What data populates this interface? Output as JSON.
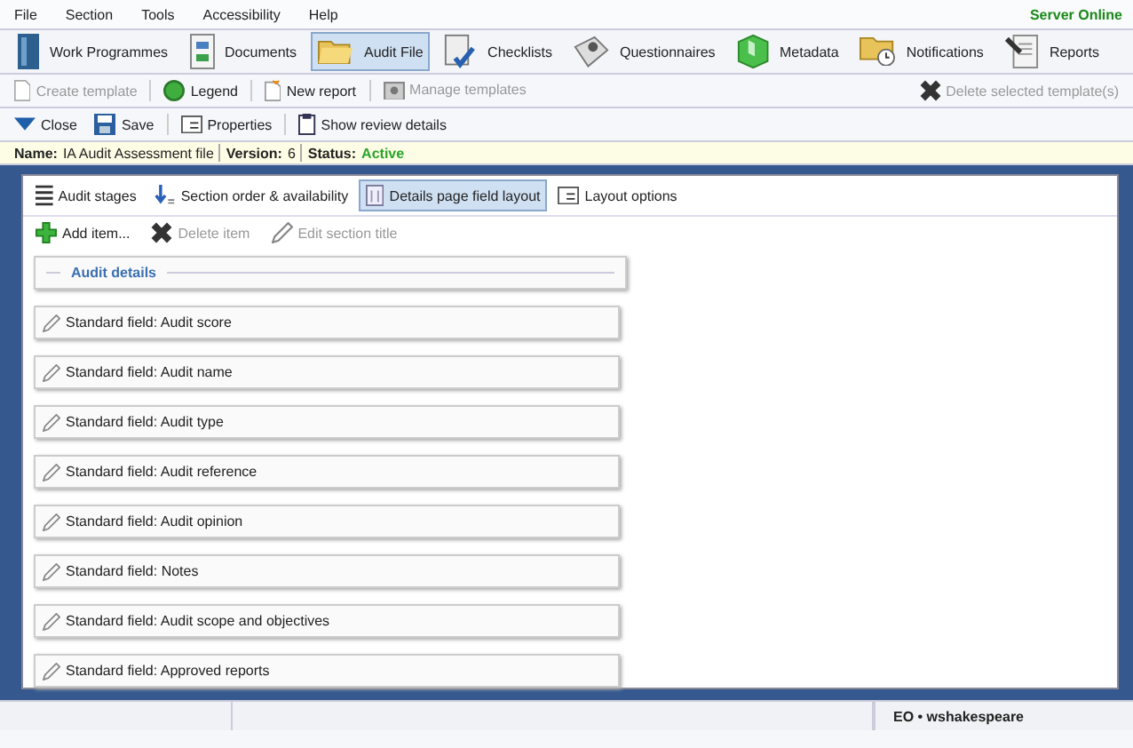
{
  "menu": [
    "File",
    "Section",
    "Tools",
    "Accessibility",
    "Help"
  ],
  "server_status": "Server Online",
  "modules": [
    {
      "label": "Work Programmes",
      "selected": false
    },
    {
      "label": "Documents",
      "selected": false
    },
    {
      "label": "Audit File",
      "selected": true
    },
    {
      "label": "Checklists",
      "selected": false
    },
    {
      "label": "Questionnaires",
      "selected": false
    },
    {
      "label": "Metadata",
      "selected": false
    },
    {
      "label": "Notifications",
      "selected": false
    },
    {
      "label": "Reports",
      "selected": false
    }
  ],
  "template_toolbar": {
    "left": [
      {
        "label": "Create template",
        "disabled": true
      },
      {
        "label": "Legend",
        "disabled": false
      },
      {
        "label": "New report",
        "disabled": false
      },
      {
        "label": "Manage templates",
        "disabled": true
      }
    ],
    "right": [
      {
        "label": "Delete selected template(s)",
        "disabled": true
      }
    ]
  },
  "actions": [
    "Close",
    "Save",
    "Properties",
    "Show review details"
  ],
  "info": [
    {
      "label": "Name:",
      "value": "IA Audit Assessment file",
      "kind": "plain"
    },
    {
      "label": "Version:",
      "value": "6",
      "kind": "plain"
    },
    {
      "label": "Status:",
      "value": "Active",
      "kind": "status"
    }
  ],
  "tabs": [
    {
      "label": "Audit stages",
      "selected": false
    },
    {
      "label": "Section order & availability",
      "selected": false
    },
    {
      "label": "Details page field layout",
      "selected": true
    },
    {
      "label": "Layout options",
      "selected": false
    }
  ],
  "item_toolbar": [
    {
      "label": "Add item...",
      "disabled": false
    },
    {
      "label": "Delete item",
      "disabled": true
    },
    {
      "label": "Edit section title",
      "disabled": true
    }
  ],
  "section_title": "Audit details",
  "fields": [
    "Standard field: Audit score",
    "Standard field: Audit name",
    "Standard field: Audit type",
    "Standard field: Audit reference",
    "Standard field: Audit opinion",
    "Standard field: Notes",
    "Standard field: Audit scope and objectives",
    "Standard field: Approved reports"
  ],
  "status_bar": {
    "user": "EO • wshakespeare"
  }
}
